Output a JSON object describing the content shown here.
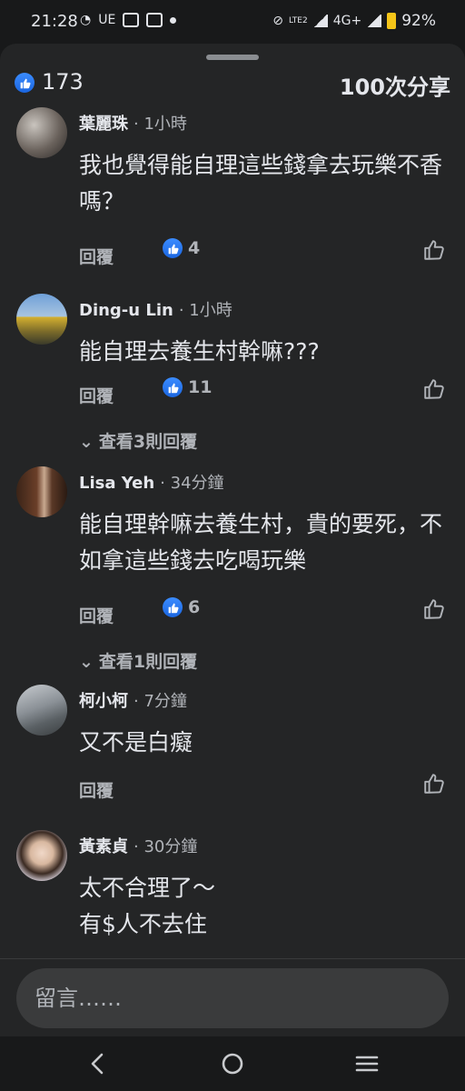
{
  "status": {
    "time": "21:28",
    "left_icons": [
      "messenger-icon",
      "ue-icon",
      "camera-icon",
      "wallet-icon",
      "dot-icon"
    ],
    "left_text": "UE",
    "network": "4G+",
    "lte": "LTE2",
    "battery": "92%"
  },
  "summary": {
    "likes": "173",
    "shares": "100次分享"
  },
  "comments": [
    {
      "author": "葉麗珠",
      "time": "· 1小時",
      "text": "我也覺得能自理這些錢拿去玩樂不香嗎？",
      "reply": "回覆",
      "likes": "4",
      "view_replies": ""
    },
    {
      "author": "Ding-u Lin",
      "time": "· 1小時",
      "text": "能自理去養生村幹嘛???",
      "reply": "回覆",
      "likes": "11",
      "view_replies": "查看3則回覆"
    },
    {
      "author": "Lisa Yeh",
      "time": "· 34分鐘",
      "text": "能自理幹嘛去養生村，貴的要死，不如拿這些錢去吃喝玩樂",
      "reply": "回覆",
      "likes": "6",
      "view_replies": "查看1則回覆"
    },
    {
      "author": "柯小柯",
      "time": "· 7分鐘",
      "text": "又不是白癡",
      "reply": "回覆",
      "likes": "",
      "view_replies": ""
    },
    {
      "author": "黃素貞",
      "time": "· 30分鐘",
      "text": "太不合理了～\n有$人不去住",
      "reply": "",
      "likes": "",
      "view_replies": ""
    }
  ],
  "input": {
    "placeholder": "留言……"
  },
  "colors": {
    "background": "#18191a",
    "sheet": "#242526",
    "like_blue": "#1b74e4"
  },
  "nav": [
    "back-icon",
    "home-icon",
    "recents-icon"
  ]
}
